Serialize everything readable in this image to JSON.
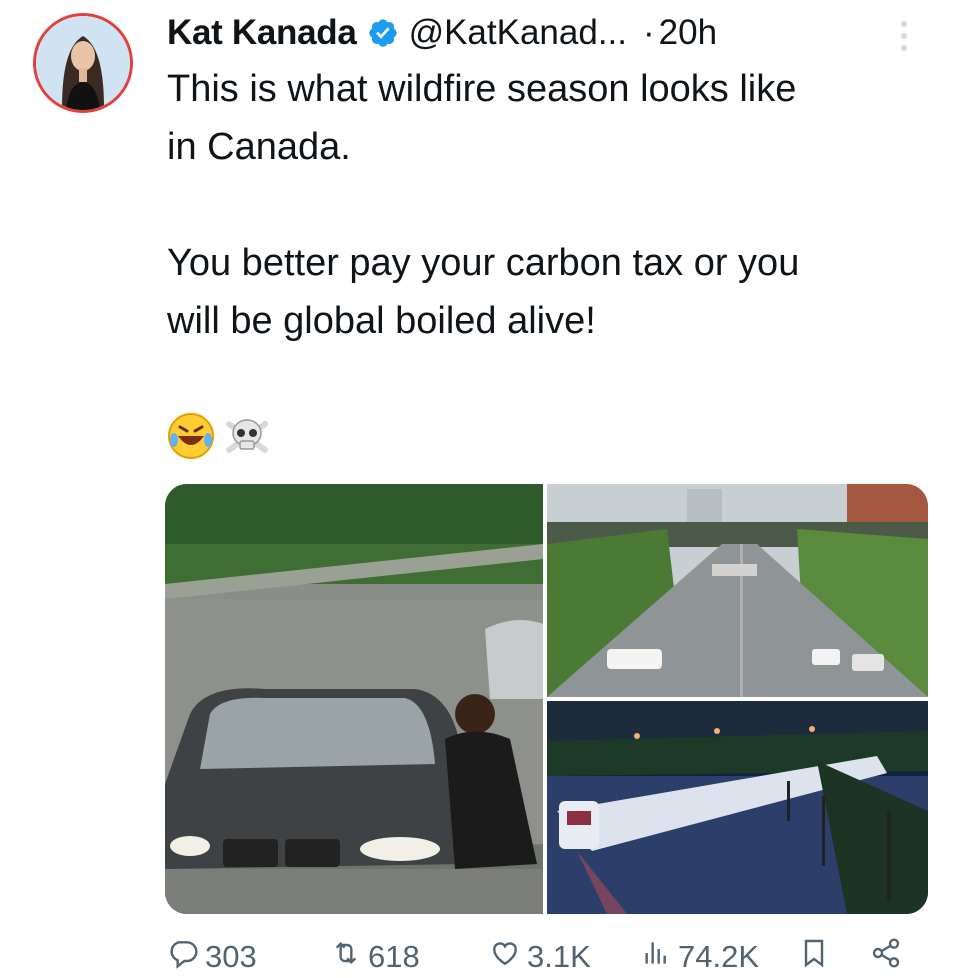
{
  "tweet": {
    "author_name": "Kat Kanada",
    "handle": "@KatKanad...",
    "separator": "·",
    "time": "20h",
    "text": "This is what wildfire season looks like\nin Canada.\n\nYou better pay your carbon tax or you\nwill be global boiled alive!",
    "emojis": [
      "🤣",
      "☠️"
    ]
  },
  "icons": {
    "verified": "verified-badge-icon",
    "more": "more-vertical-icon",
    "reply": "reply-icon",
    "retweet": "retweet-icon",
    "like": "like-icon",
    "views": "views-icon",
    "bookmark": "bookmark-icon",
    "share": "share-icon"
  },
  "actions": {
    "replies": "303",
    "retweets": "618",
    "likes": "3.1K",
    "views": "74.2K"
  },
  "colors": {
    "verified": "#1d9bf0",
    "avatar_ring": "#e0413f",
    "action_gray": "#536471",
    "text": "#0f1419"
  }
}
